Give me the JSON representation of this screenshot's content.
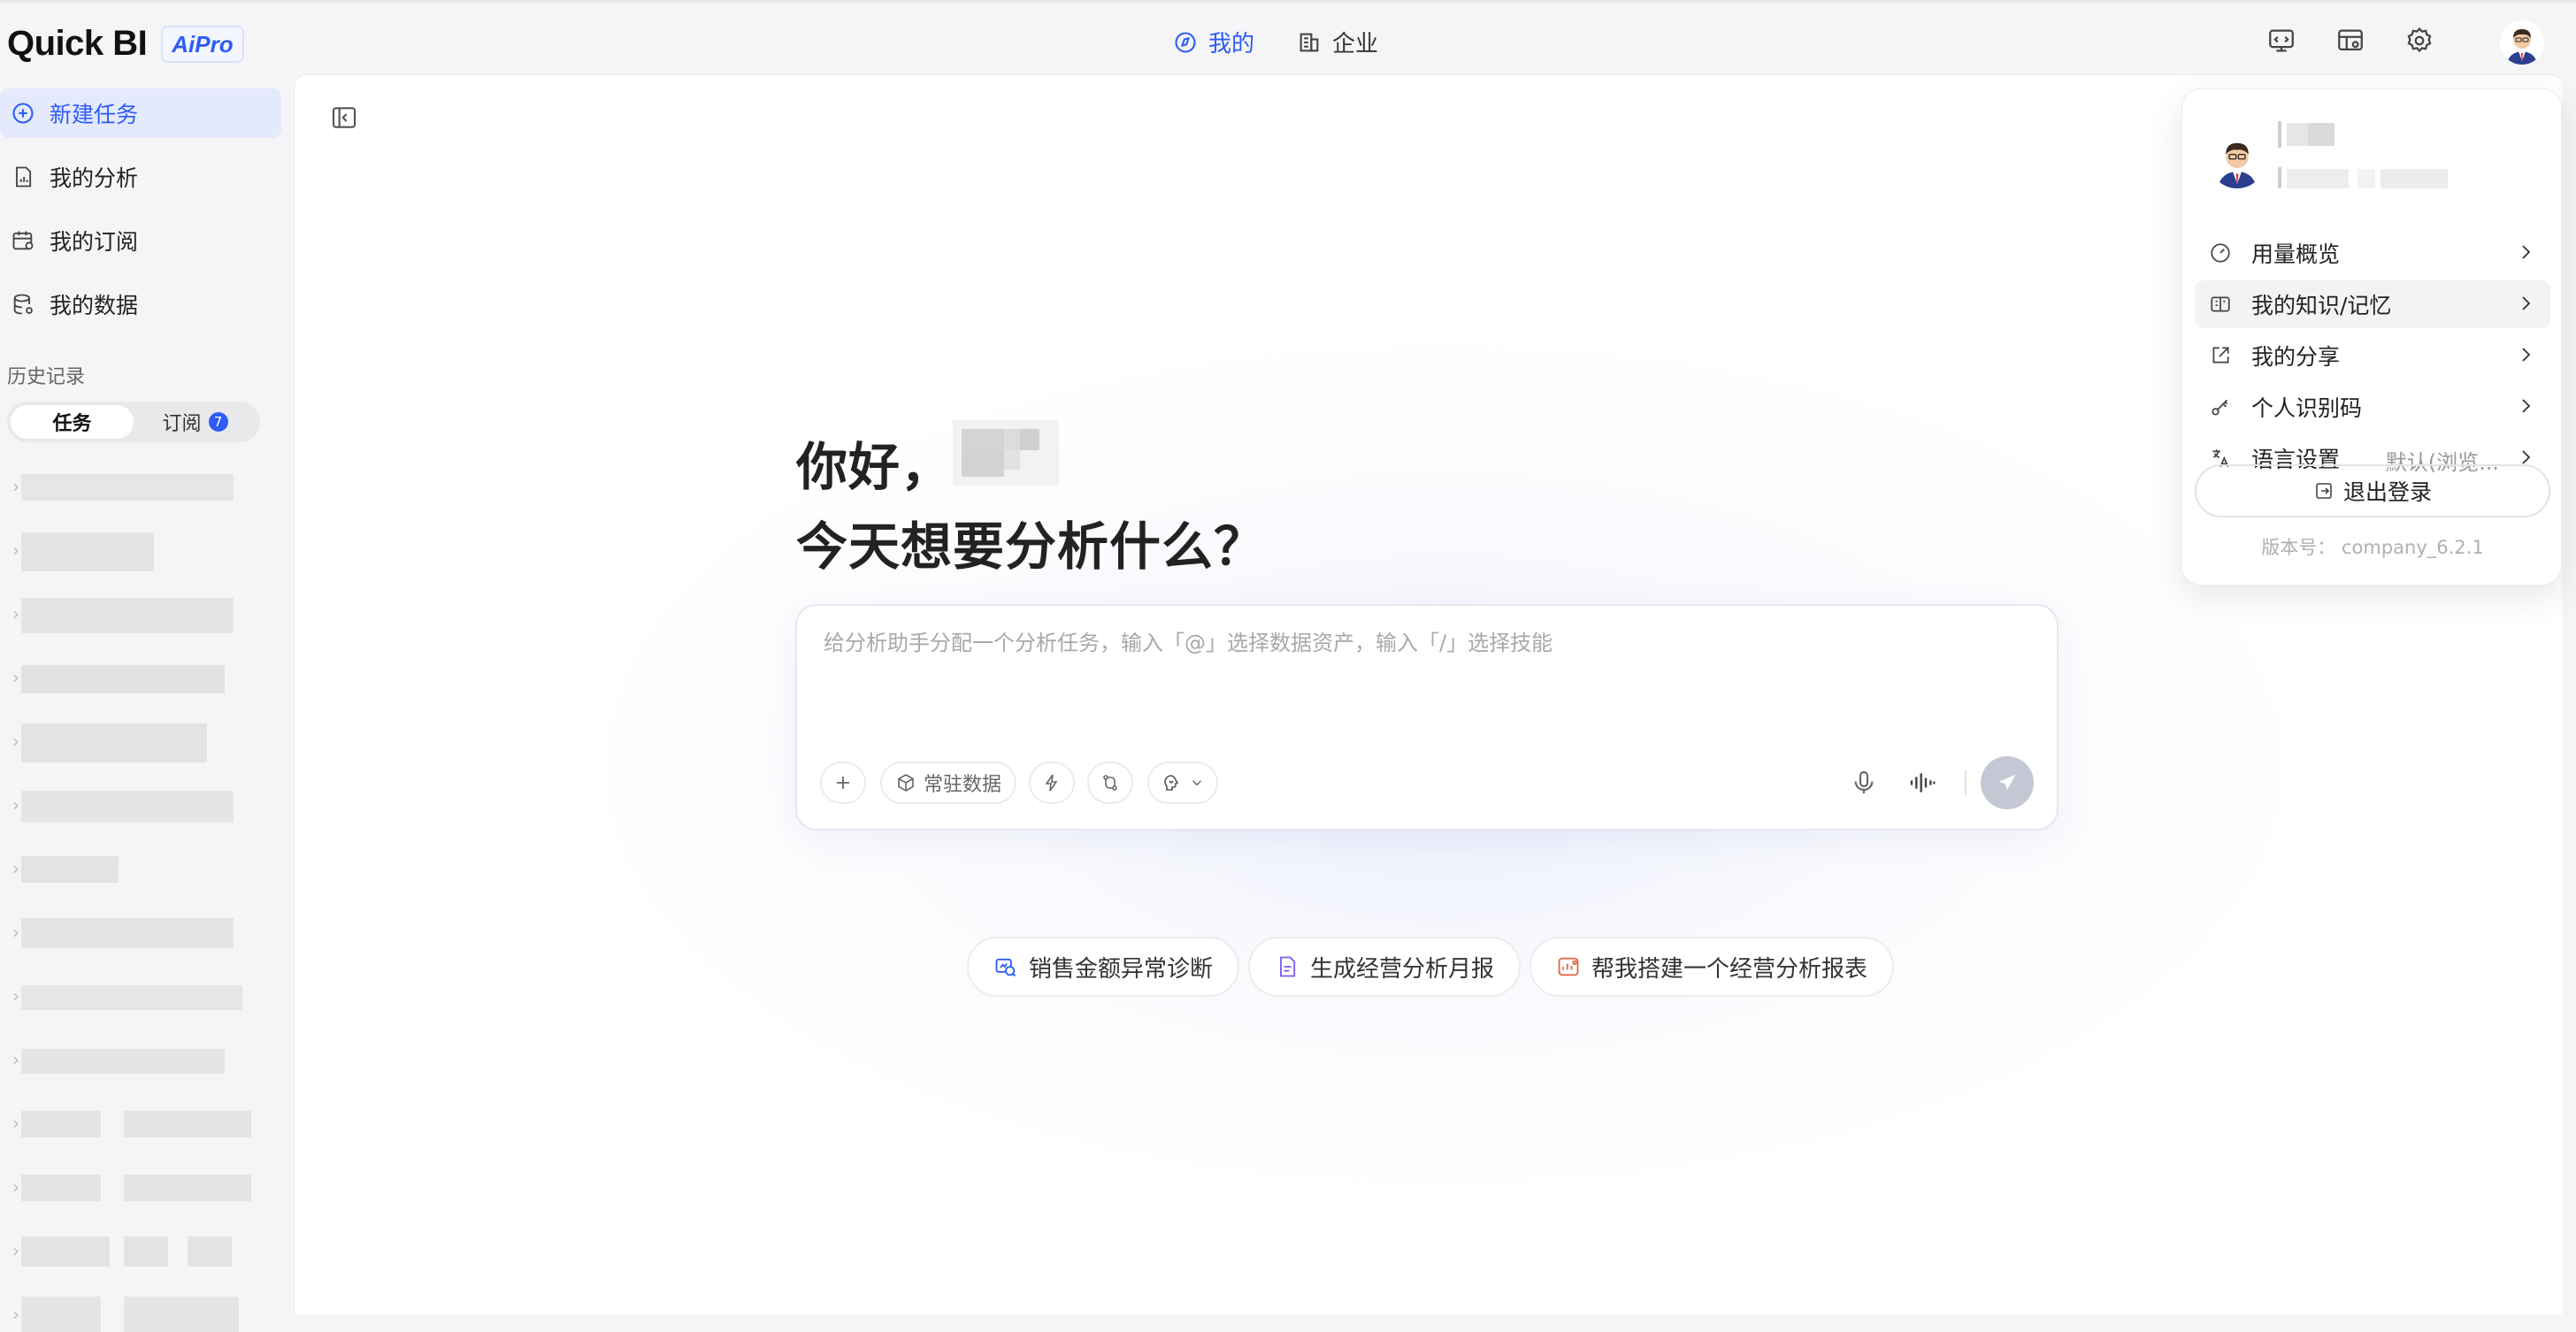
{
  "header": {
    "logo": "Quick BI",
    "logo_badge": "AiPro",
    "tabs": [
      {
        "label": "我的",
        "icon": "compass-icon",
        "active": true
      },
      {
        "label": "企业",
        "icon": "building-icon",
        "active": false
      }
    ],
    "icons": [
      "code-window-icon",
      "table-settings-icon",
      "gear-icon"
    ],
    "accent_color": "#2d5cf6"
  },
  "sidebar": {
    "items": [
      {
        "label": "新建任务",
        "icon": "plus-circle-icon",
        "active": true
      },
      {
        "label": "我的分析",
        "icon": "document-chart-icon",
        "active": false
      },
      {
        "label": "我的订阅",
        "icon": "calendar-icon",
        "active": false
      },
      {
        "label": "我的数据",
        "icon": "database-icon",
        "active": false
      }
    ],
    "history_title": "历史记录",
    "segments": [
      {
        "label": "任务",
        "active": true
      },
      {
        "label": "订阅",
        "badge": "7",
        "active": false
      }
    ]
  },
  "main": {
    "greeting": "你好，",
    "question": "今天想要分析什么？",
    "composer": {
      "placeholder": "给分析助手分配一个分析任务，输入「@」选择数据资产，输入「/」选择技能",
      "resident_data_label": "常驻数据"
    },
    "suggestions": [
      {
        "label": "销售金额异常诊断",
        "icon": "diagnose-icon"
      },
      {
        "label": "生成经营分析月报",
        "icon": "report-doc-icon"
      },
      {
        "label": "帮我搭建一个经营分析报表",
        "icon": "dashboard-build-icon"
      }
    ]
  },
  "user_menu": {
    "items": [
      {
        "label": "用量概览",
        "icon": "gauge-icon"
      },
      {
        "label": "我的知识/记忆",
        "icon": "knowledge-icon",
        "hover": true
      },
      {
        "label": "我的分享",
        "icon": "share-icon"
      },
      {
        "label": "个人识别码",
        "icon": "key-icon"
      },
      {
        "label": "语言设置",
        "icon": "translate-icon",
        "value": "默认(浏览..."
      }
    ],
    "logout_label": "退出登录",
    "version": "版本号：  company_6.2.1"
  }
}
